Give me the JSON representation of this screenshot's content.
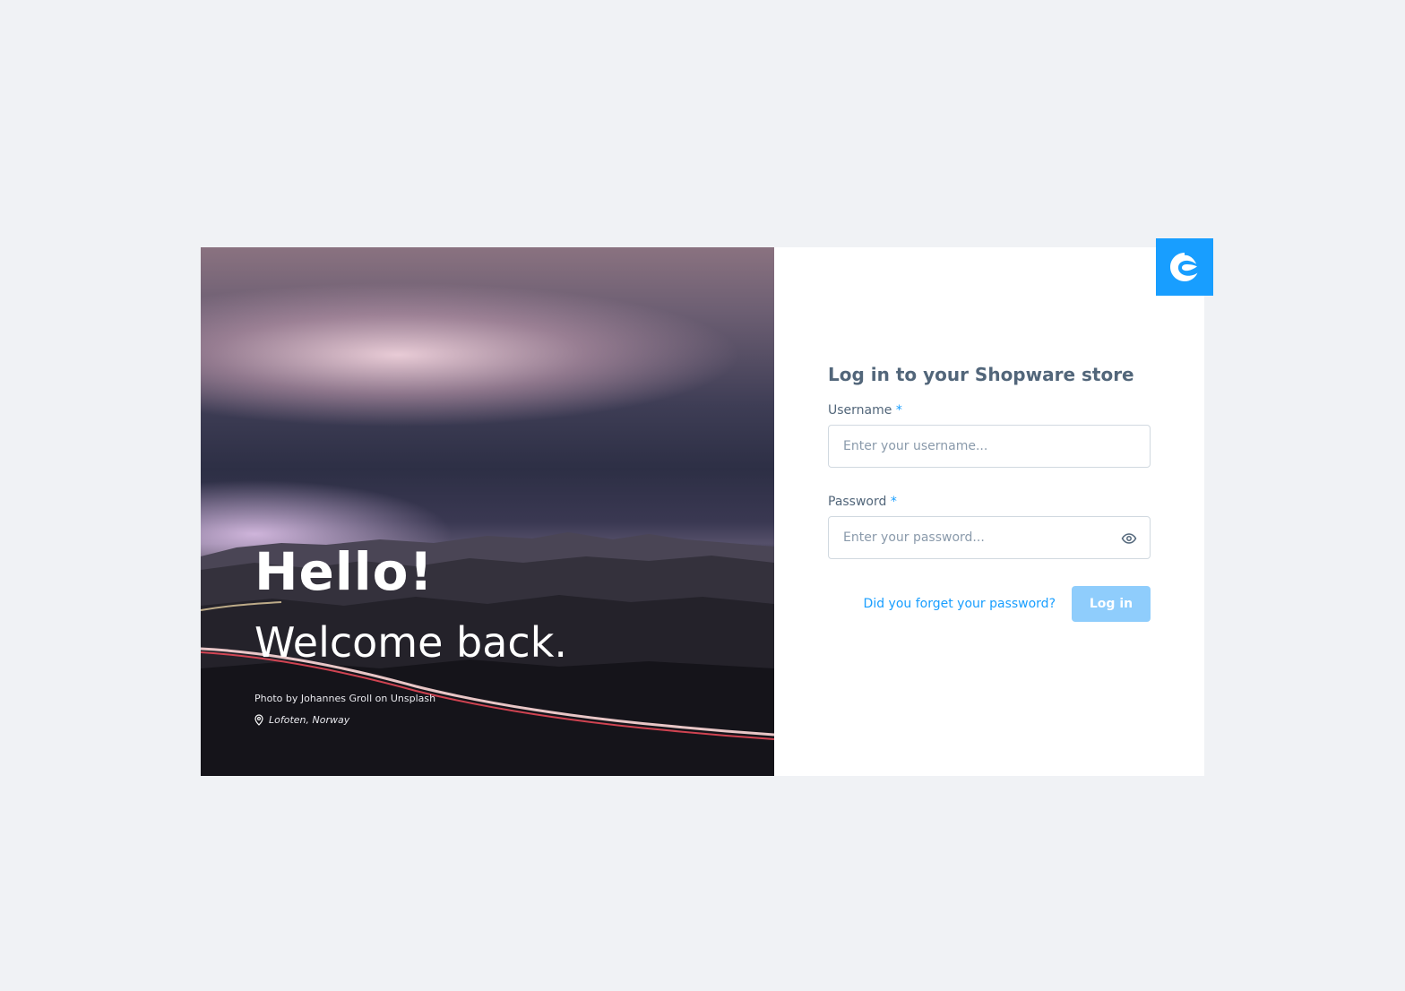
{
  "photo": {
    "heading": "Hello!",
    "subheading": "Welcome back.",
    "credit": "Photo by Johannes Groll on Unsplash",
    "location": "Lofoten, Norway",
    "location_icon": "map-pin-icon"
  },
  "brand": {
    "logo_icon": "shopware-logo-icon",
    "color": "#189eff"
  },
  "form": {
    "title": "Log in to your Shopware store",
    "username": {
      "label": "Username",
      "required_marker": "*",
      "placeholder": "Enter your username...",
      "value": ""
    },
    "password": {
      "label": "Password",
      "required_marker": "*",
      "placeholder": "Enter your password...",
      "value": "",
      "toggle_icon": "eye-icon"
    },
    "forgot_link": "Did you forget your password?",
    "login_button": "Log in",
    "colors": {
      "label": "#52667a",
      "link": "#189eff",
      "button_disabled": "#8fcdfc",
      "page_background": "#f0f2f5"
    }
  }
}
